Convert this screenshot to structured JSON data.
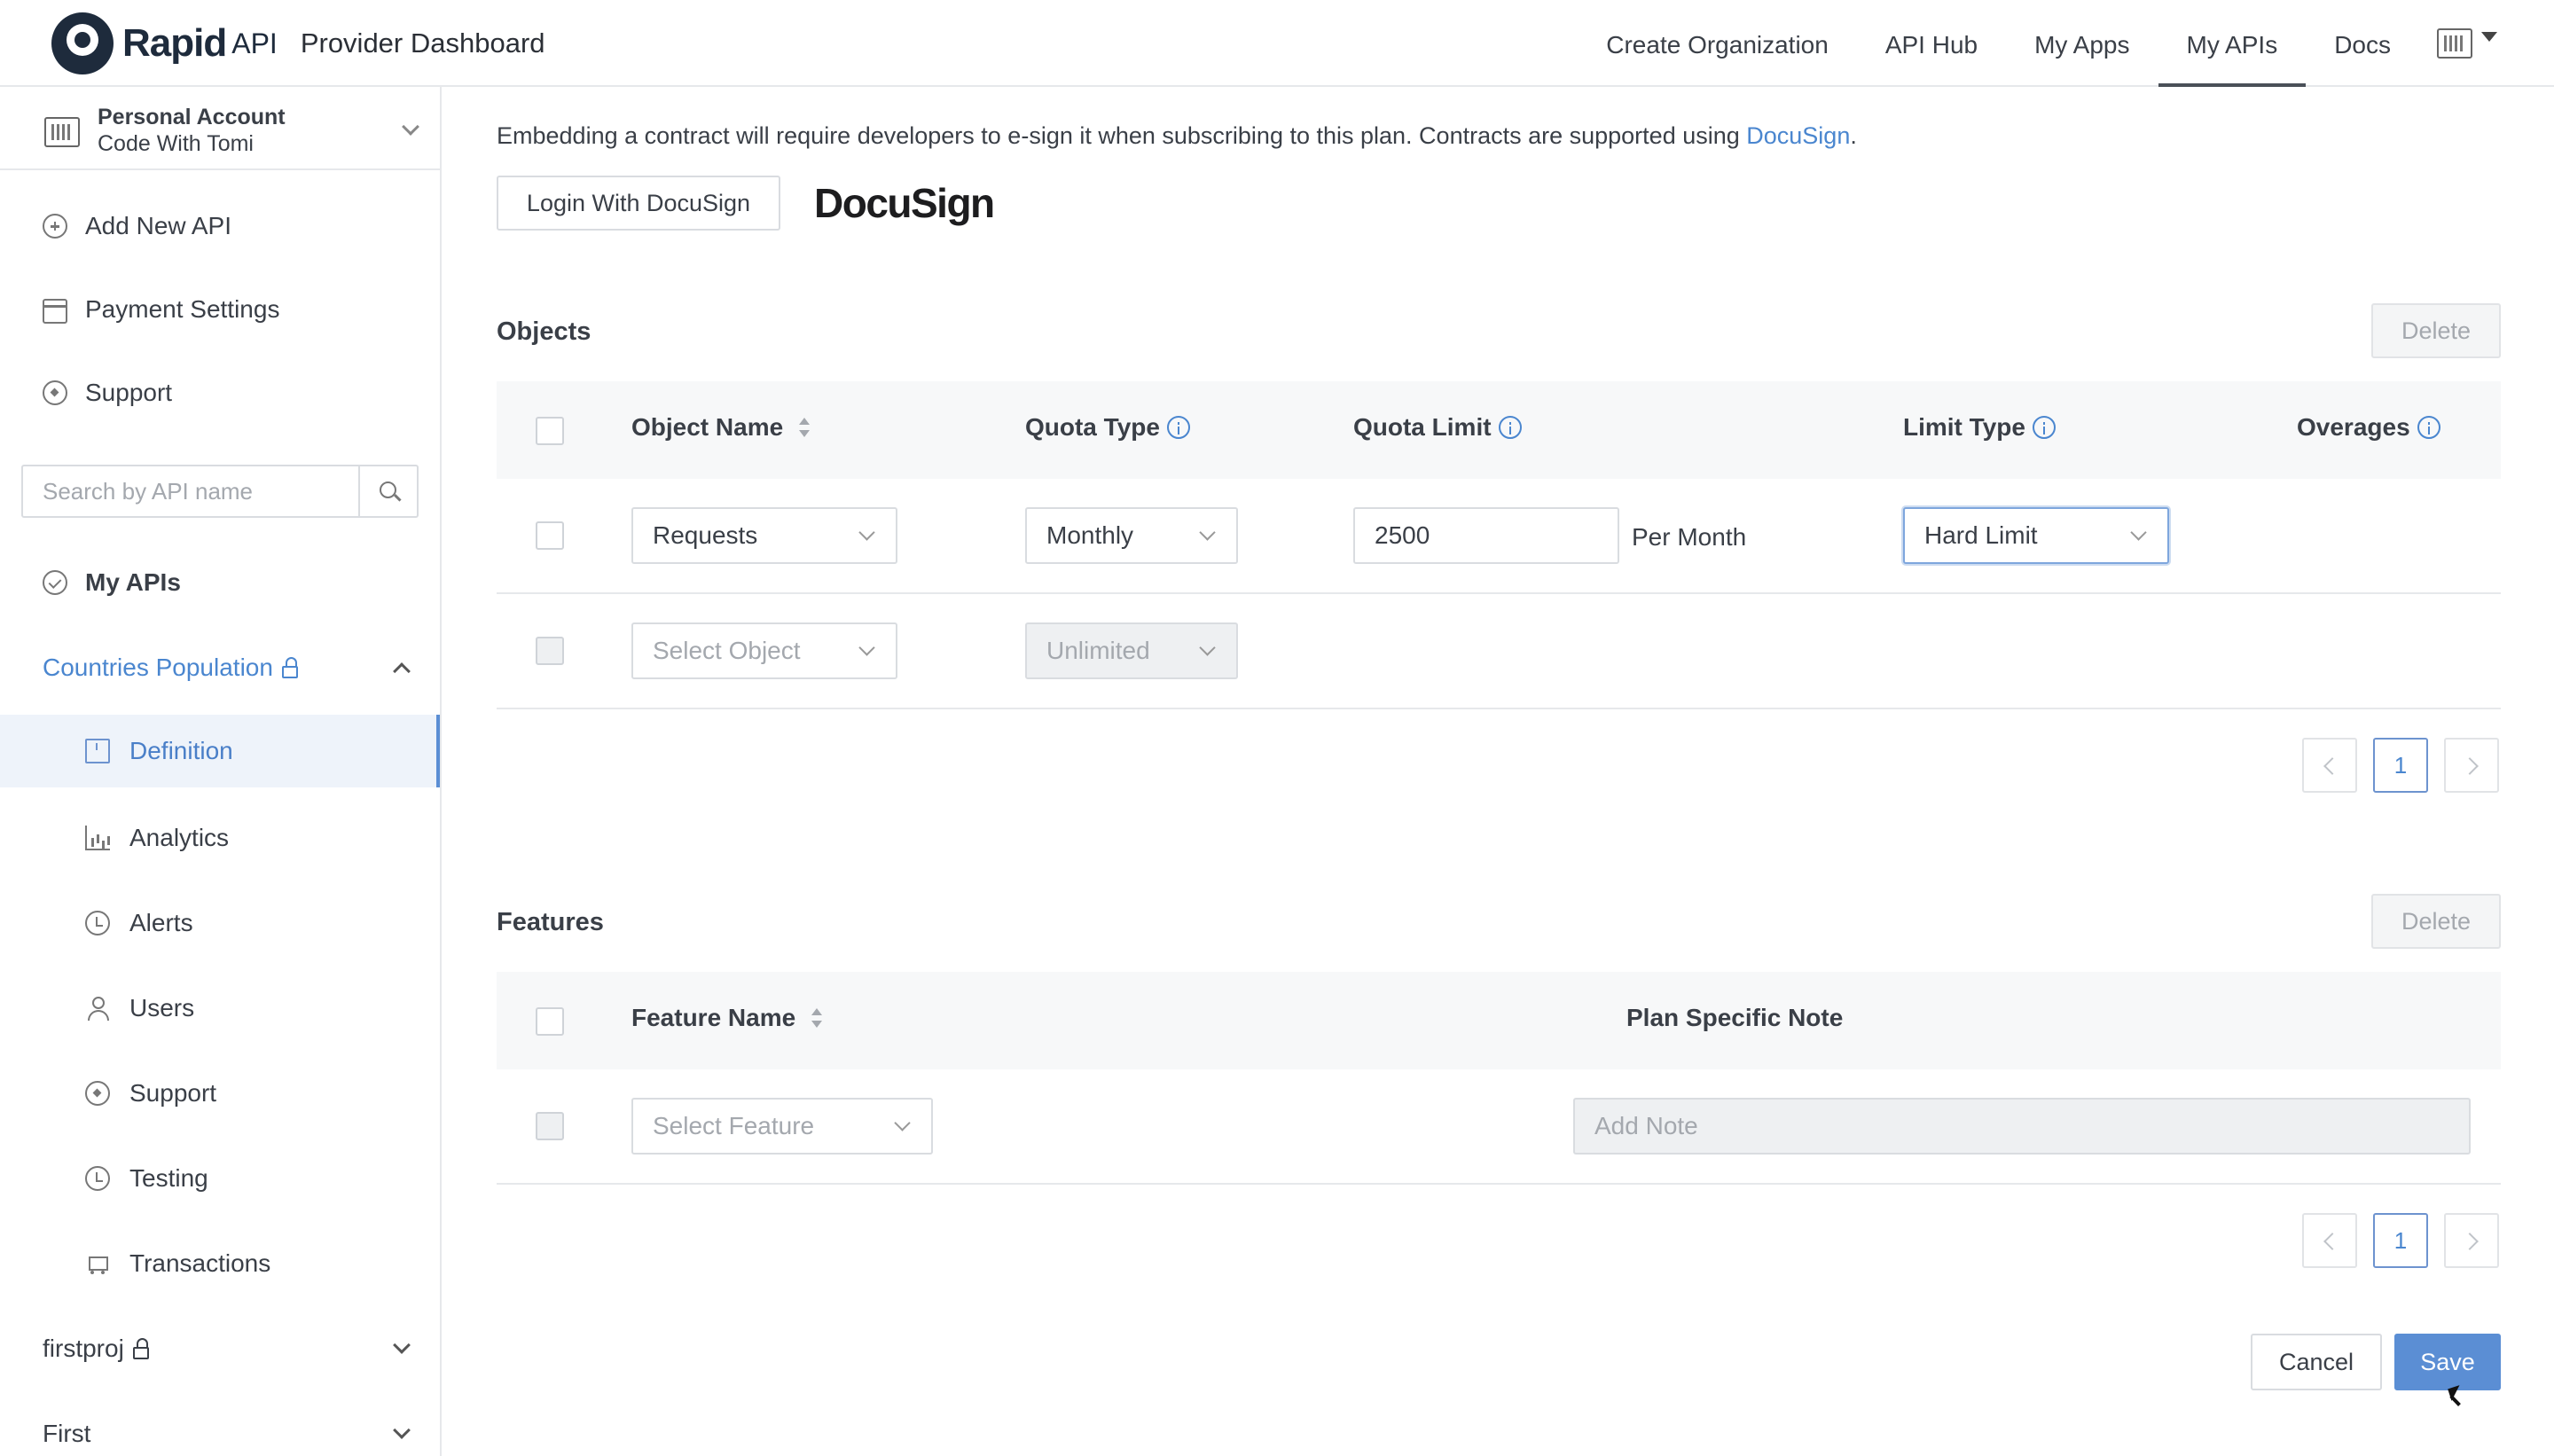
{
  "header": {
    "logo_text": "Rapid",
    "logo_api": "API",
    "subtitle": "Provider Dashboard",
    "nav": [
      "Create Organization",
      "API Hub",
      "My Apps",
      "My APIs",
      "Docs"
    ],
    "active_nav": "My APIs"
  },
  "sidebar": {
    "account_name": "Personal Account",
    "account_sub": "Code With Tomi",
    "add_new_api": "Add New API",
    "payment_settings": "Payment Settings",
    "support": "Support",
    "search_placeholder": "Search by API name",
    "my_apis": "My APIs",
    "project_name": "Countries Population",
    "sub_items": [
      "Definition",
      "Analytics",
      "Alerts",
      "Users",
      "Support",
      "Testing",
      "Transactions"
    ],
    "active_sub": "Definition",
    "other_projects": [
      "firstproj",
      "First"
    ]
  },
  "contract": {
    "text": "Embedding a contract will require developers to e-sign it when subscribing to this plan. Contracts are supported using ",
    "link": "DocuSign",
    "period": ".",
    "login_button": "Login With DocuSign",
    "logo_text": "DocuSign"
  },
  "objects": {
    "title": "Objects",
    "delete_label": "Delete",
    "columns": {
      "object_name": "Object Name",
      "quota_type": "Quota Type",
      "quota_limit": "Quota Limit",
      "limit_type": "Limit Type",
      "overages": "Overages"
    },
    "rows": [
      {
        "object": "Requests",
        "quota_type": "Monthly",
        "quota_limit": "2500",
        "per": "Per Month",
        "limit_type": "Hard Limit"
      },
      {
        "object": "Select Object",
        "quota_type": "Unlimited"
      }
    ],
    "page": "1"
  },
  "features": {
    "title": "Features",
    "delete_label": "Delete",
    "columns": {
      "feature_name": "Feature Name",
      "plan_note": "Plan Specific Note"
    },
    "row": {
      "feature_placeholder": "Select Feature",
      "note_placeholder": "Add Note"
    },
    "page": "1"
  },
  "actions": {
    "cancel": "Cancel",
    "save": "Save"
  },
  "colors": {
    "accent": "#5b8ed4",
    "link": "#4a86cf",
    "brand_dark": "#1e2b3c"
  }
}
